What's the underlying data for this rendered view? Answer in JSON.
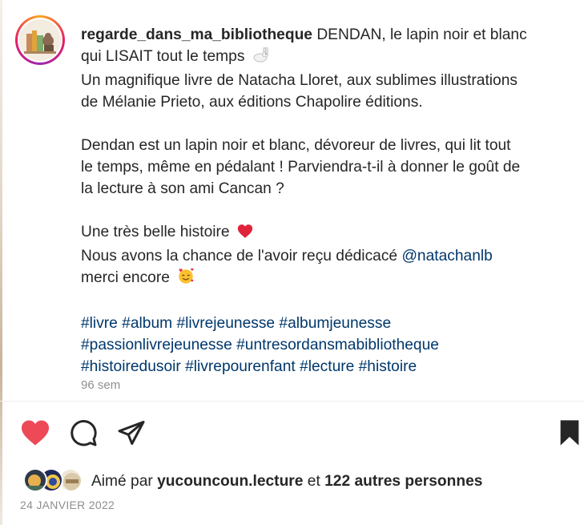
{
  "post": {
    "username": "regarde_dans_ma_bibliotheque",
    "caption_first_line": "DENDAN, le lapin noir et blanc",
    "lines": [
      "qui LISAIT tout le temps",
      "Un magnifique livre de Natacha Lloret, aux sublimes illustrations",
      "de Mélanie Prieto, aux éditions Chapolire éditions.",
      "Dendan est un lapin noir et blanc, dévoreur de livres, qui lit tout",
      "le temps, même en pédalant ! Parviendra-t-il à donner le goût de",
      "la lecture à son ami Cancan ?",
      "Une très belle histoire",
      "Nous avons la chance de l'avoir reçu dédicacé",
      "merci encore"
    ],
    "mention": "@natachanlb",
    "hashtag_lines": [
      "#livre #album #livrejeunesse #albumjeunesse",
      "#passionlivrejeunesse #untresordansmabibliotheque",
      "#histoiredusoir #livrepourenfant #lecture #histoire"
    ],
    "time_ago": "96 sem"
  },
  "likes": {
    "prefix": "Aimé par",
    "first_liker": "yucouncoun.lecture",
    "connector": "et",
    "others": "122 autres personnes"
  },
  "date": "24 JANVIER 2022",
  "icons": [
    "heart-icon",
    "comment-icon",
    "share-icon",
    "bookmark-icon",
    "rabbit-emoji",
    "heart-emoji",
    "smiling-face-with-hearts-emoji"
  ],
  "colors": {
    "like_red": "#ed4956",
    "link_blue": "#00376b",
    "muted": "#8e8e8e"
  }
}
